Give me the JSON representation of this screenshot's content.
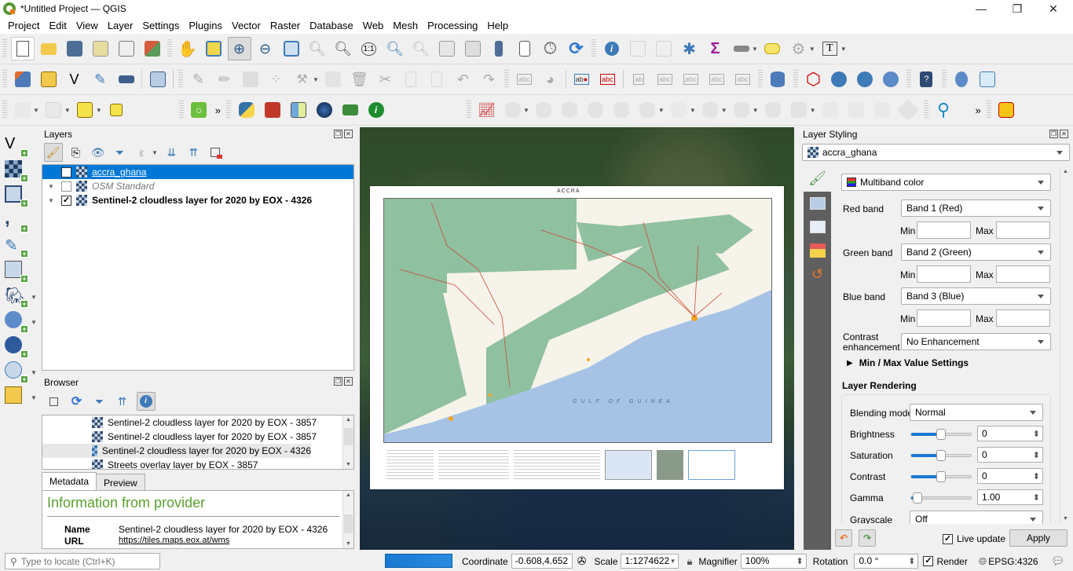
{
  "window": {
    "title": "*Untitled Project — QGIS",
    "controls": {
      "minimize": "—",
      "restore": "❐",
      "close": "✕"
    }
  },
  "menu": [
    "Project",
    "Edit",
    "View",
    "Layer",
    "Settings",
    "Plugins",
    "Vector",
    "Raster",
    "Database",
    "Web",
    "Mesh",
    "Processing",
    "Help"
  ],
  "toolbars": {
    "row1": [
      "new-project",
      "open-project",
      "save-project",
      "new-print-layout",
      "layout-manager",
      "style-manager",
      "pan-map",
      "pan-to-selection",
      "zoom-in",
      "zoom-out",
      "zoom-full",
      "zoom-to-selection",
      "zoom-to-layer",
      "zoom-native",
      "zoom-last",
      "zoom-next",
      "new-spatial-bookmark",
      "show-bookmarks",
      "new-3d-map",
      "new-map-view",
      "temporal-controller",
      "refresh",
      "identify-features",
      "open-attribute-table",
      "attribute-calculator",
      "toolbox",
      "statistical-summary",
      "measure-line",
      "map-tips",
      "action",
      "text-annotation"
    ],
    "row2": [
      "data-source-manager",
      "new-geopackage-layer",
      "new-shapefile-layer",
      "new-temporary-scratch-layer",
      "new-virtual-layer",
      "new-mesh-layer",
      "current-edits",
      "toggle-editing",
      "save-edits",
      "digitize",
      "vertex-tool",
      "modify-attributes",
      "delete-selected",
      "cut-features",
      "copy-features",
      "paste-features",
      "undo",
      "redo",
      "label-toolbar",
      "diagram-options",
      "layer-labeling",
      "highlight-pinned-labels",
      "pin-labels",
      "show-hide-labels",
      "move-label",
      "rotate-label",
      "change-label",
      "db-manager",
      "geometry-checker",
      "add-wms-layer",
      "add-wcs-layer",
      "metasearch",
      "qgis-help",
      "georeferencer",
      "update-topology"
    ],
    "row3": [
      "select-features",
      "deselect",
      "select-by-expression",
      "select-by-location",
      "locator-search",
      "more-arrow",
      "python-console",
      "heatmap",
      "swipe-tool",
      "globe",
      "shapes",
      "identify-plugin",
      "time-series",
      "advanced-digitizing"
    ],
    "more_label": "»"
  },
  "layers_panel": {
    "title": "Layers",
    "items": [
      {
        "name": "accra_ghana",
        "checked": true,
        "selected": true,
        "style": "link"
      },
      {
        "name": "OSM Standard",
        "checked": false,
        "selected": false,
        "style": "italic"
      },
      {
        "name": "Sentinel-2 cloudless layer for 2020 by EOX - 4326",
        "checked": true,
        "selected": false,
        "style": "bold"
      }
    ]
  },
  "browser_panel": {
    "title": "Browser",
    "items": [
      "Sentinel-2 cloudless layer for 2020 by EOX - 3857",
      "Sentinel-2 cloudless layer for 2020 by EOX - 3857",
      "Sentinel-2 cloudless layer for 2020 by EOX - 4326",
      "Streets overlay layer by EOX - 3857"
    ],
    "highlighted_index": 2,
    "tabs": [
      "Metadata",
      "Preview"
    ],
    "active_tab": "Metadata",
    "metadata": {
      "heading": "Information from provider",
      "rows": [
        {
          "key": "Name",
          "value": "Sentinel-2 cloudless layer for 2020 by EOX - 4326"
        },
        {
          "key": "URL",
          "value": "https://tiles.maps.eox.at/wms"
        }
      ]
    }
  },
  "locator": {
    "placeholder": "Type to locate (Ctrl+K)"
  },
  "map": {
    "sheet_title": "ACCRA",
    "sea_label": "GULF OF GUINEA"
  },
  "styling_panel": {
    "title": "Layer Styling",
    "layer": "accra_ghana",
    "renderer": "Multiband color",
    "red_band": {
      "label": "Red band",
      "value": "Band 1 (Red)",
      "min": "",
      "max": ""
    },
    "green_band": {
      "label": "Green band",
      "value": "Band 2 (Green)",
      "min": "",
      "max": ""
    },
    "blue_band": {
      "label": "Blue band",
      "value": "Band 3 (Blue)",
      "min": "",
      "max": ""
    },
    "min_label": "Min",
    "max_label": "Max",
    "contrast": {
      "label_line1": "Contrast",
      "label_line2": "enhancement",
      "value": "No Enhancement"
    },
    "minmax_section": "Min / Max Value Settings",
    "rendering_section": "Layer Rendering",
    "blending": {
      "label": "Blending mode",
      "value": "Normal"
    },
    "brightness": {
      "label": "Brightness",
      "value": "0",
      "slider_fraction": 0.5
    },
    "saturation": {
      "label": "Saturation",
      "value": "0",
      "slider_fraction": 0.5
    },
    "contrast_adj": {
      "label": "Contrast",
      "value": "0",
      "slider_fraction": 0.5
    },
    "gamma": {
      "label": "Gamma",
      "value": "1.00",
      "slider_fraction": 0.1
    },
    "grayscale": {
      "label": "Grayscale",
      "value": "Off"
    },
    "live_update": {
      "label": "Live update",
      "checked": true
    },
    "apply_label": "Apply"
  },
  "statusbar": {
    "coordinate_label": "Coordinate",
    "coordinate": "-0.608,4.652",
    "scale_label": "Scale",
    "scale": "1:1274622",
    "magnifier_label": "Magnifier",
    "magnifier": "100%",
    "rotation_label": "Rotation",
    "rotation": "0.0 °",
    "render_label": "Render",
    "render_checked": true,
    "crs": "EPSG:4326"
  },
  "colors": {
    "accent": "#0078d7",
    "selection": "#0078d7",
    "progress": "#1979d2",
    "metadata_heading": "#5aa02c"
  }
}
